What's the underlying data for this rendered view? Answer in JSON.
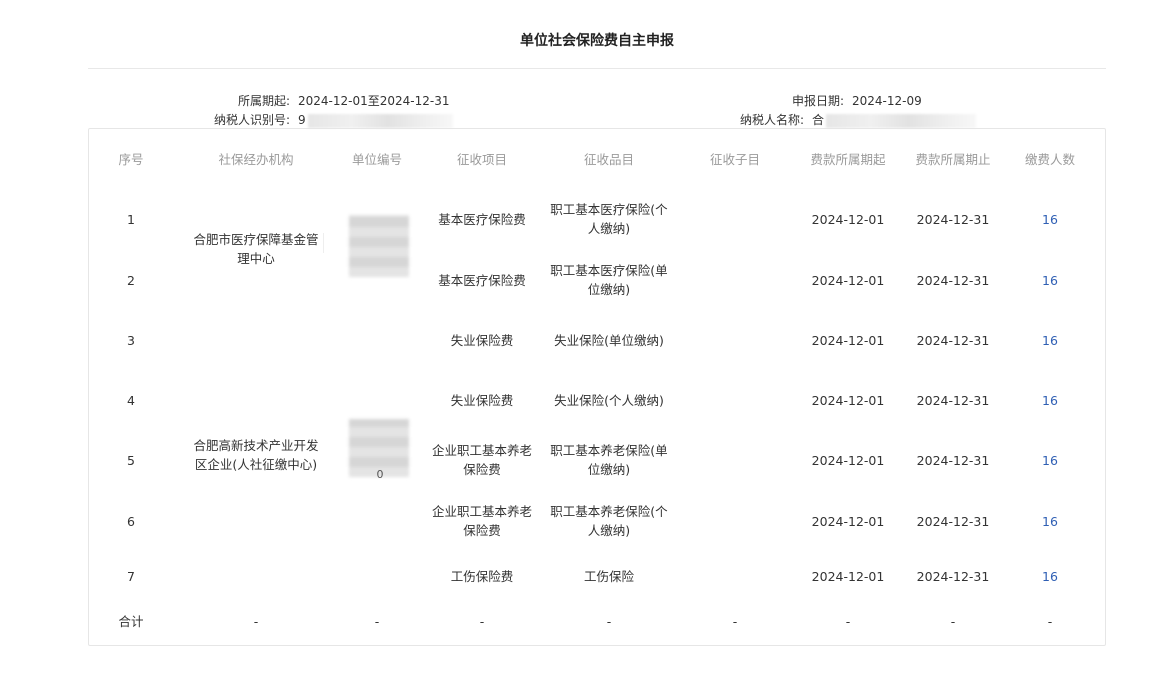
{
  "page": {
    "title": "单位社会保险费自主申报"
  },
  "meta": {
    "period_label": "所属期起:",
    "period_value": "2024-12-01至2024-12-31",
    "taxpayer_id_label": "纳税人识别号:",
    "taxpayer_id_visible": "9",
    "report_date_label": "申报日期:",
    "report_date_value": "2024-12-09",
    "taxpayer_name_label": "纳税人名称:",
    "taxpayer_name_visible": "合"
  },
  "table": {
    "headers": [
      "序号",
      "社保经办机构",
      "单位编号",
      "征收项目",
      "征收品目",
      "征收子目",
      "费款所属期起",
      "费款所属期止",
      "缴费人数"
    ],
    "agencies": [
      "合肥市医疗保障基金管理中心",
      "合肥高新技术产业开发区企业(人社征缴中心)"
    ],
    "unit_code_fragment": "0",
    "rows": [
      {
        "seq": "1",
        "item": "基本医疗保险费",
        "sub_item": "职工基本医疗保险(个人缴纳)",
        "sub_sub": "",
        "start": "2024-12-01",
        "end": "2024-12-31",
        "count": "16"
      },
      {
        "seq": "2",
        "item": "基本医疗保险费",
        "sub_item": "职工基本医疗保险(单位缴纳)",
        "sub_sub": "",
        "start": "2024-12-01",
        "end": "2024-12-31",
        "count": "16"
      },
      {
        "seq": "3",
        "item": "失业保险费",
        "sub_item": "失业保险(单位缴纳)",
        "sub_sub": "",
        "start": "2024-12-01",
        "end": "2024-12-31",
        "count": "16"
      },
      {
        "seq": "4",
        "item": "失业保险费",
        "sub_item": "失业保险(个人缴纳)",
        "sub_sub": "",
        "start": "2024-12-01",
        "end": "2024-12-31",
        "count": "16"
      },
      {
        "seq": "5",
        "item": "企业职工基本养老保险费",
        "sub_item": "职工基本养老保险(单位缴纳)",
        "sub_sub": "",
        "start": "2024-12-01",
        "end": "2024-12-31",
        "count": "16"
      },
      {
        "seq": "6",
        "item": "企业职工基本养老保险费",
        "sub_item": "职工基本养老保险(个人缴纳)",
        "sub_sub": "",
        "start": "2024-12-01",
        "end": "2024-12-31",
        "count": "16"
      },
      {
        "seq": "7",
        "item": "工伤保险费",
        "sub_item": "工伤保险",
        "sub_sub": "",
        "start": "2024-12-01",
        "end": "2024-12-31",
        "count": "16"
      }
    ],
    "total": {
      "label": "合计",
      "agency": "-",
      "unit_code": "-",
      "item": "-",
      "sub_item": "-",
      "sub_sub": "-",
      "start": "-",
      "end": "-",
      "count": "-"
    }
  }
}
